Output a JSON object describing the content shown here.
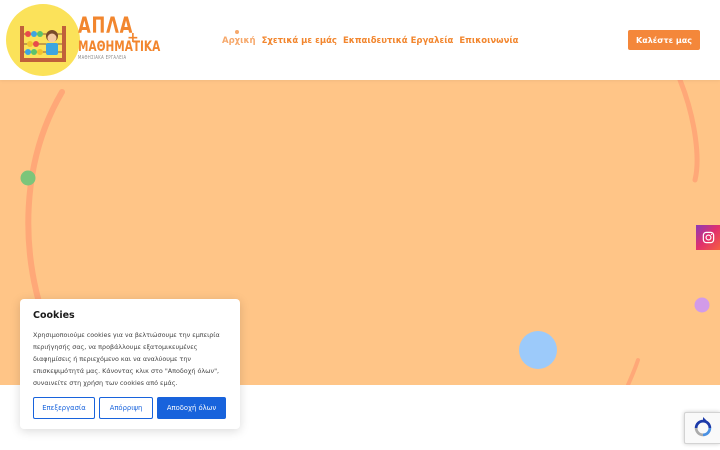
{
  "logo": {
    "line1": "ΑΠΛΑ",
    "line2": "ΜΑΘΗΜΑΤΙΚΑ",
    "line3": "ΜΑΘΗΣΙΑΚΑ ΕΡΓΑΛΕΙΑ",
    "plus": "+"
  },
  "nav": {
    "items": [
      {
        "label": "Αρχική",
        "active": true
      },
      {
        "label": "Σχετικά με εμάς",
        "active": false
      },
      {
        "label": "Εκπαιδευτικά Εργαλεία",
        "active": false
      },
      {
        "label": "Επικοινωνία",
        "active": false
      }
    ]
  },
  "header": {
    "call_button": "Καλέστε μας"
  },
  "colors": {
    "accent": "#f2862e",
    "hero_bg": "#ffc587",
    "cookie_blue": "#1863dc"
  },
  "social": {
    "instagram_icon": "instagram-icon"
  },
  "cookie": {
    "title": "Cookies",
    "text": "Χρησιμοποιούμε cookies για να βελτιώσουμε την εμπειρία περιήγησής σας, να προβάλλουμε εξατομικευμένες διαφημίσεις ή περιεχόμενο και να αναλύουμε την επισκεψιμότητά μας. Κάνοντας κλικ στο \"Αποδοχή όλων\", συναινείτε στη χρήση των cookies από εμάς.",
    "customize": "Επεξεργασία",
    "reject": "Απόρριψη",
    "accept": "Αποδοχή όλων"
  }
}
